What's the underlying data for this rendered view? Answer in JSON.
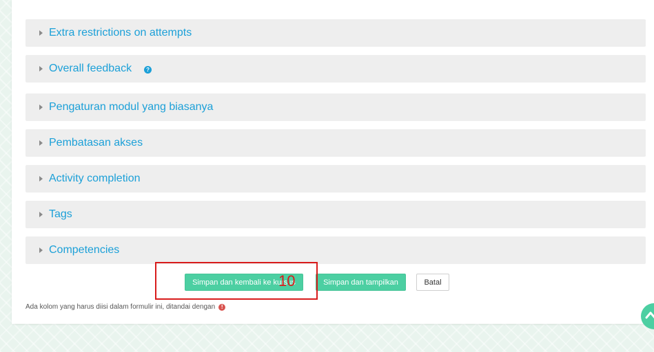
{
  "sections": [
    {
      "label": "Extra restrictions on attempts"
    },
    {
      "label": "Overall feedback",
      "help_icon": "question-circle-icon"
    },
    {
      "label": "Pengaturan modul yang biasanya"
    },
    {
      "label": "Pembatasan akses"
    },
    {
      "label": "Activity completion"
    },
    {
      "label": "Tags"
    },
    {
      "label": "Competencies"
    }
  ],
  "buttons": {
    "save_return": "Simpan dan kembali ke kursus",
    "save_display": "Simpan dan tampilkan",
    "cancel": "Batal"
  },
  "annotation": {
    "number": "10"
  },
  "required_note": "Ada kolom yang harus diisi dalam formulir ini, ditandai dengan",
  "icons": {
    "required": "exclamation-circle-icon",
    "scroll_top": "chevron-up-icon",
    "section_caret": "caret-right-icon"
  },
  "colors": {
    "accent": "#4ccfa2",
    "link": "#1ca0d8",
    "annotation": "#d81b1b"
  }
}
